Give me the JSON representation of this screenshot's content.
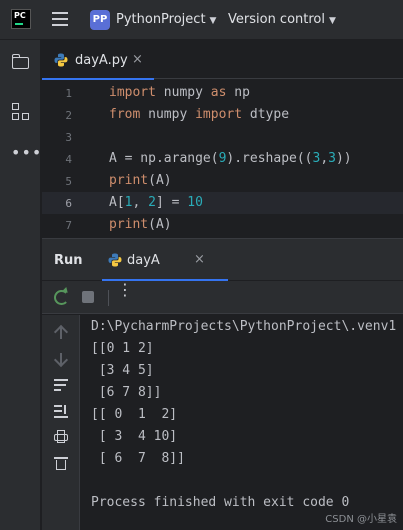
{
  "topbar": {
    "logo_text": "PC",
    "project_badge": "PP",
    "project_name": "PythonProject",
    "vcs_label": "Version control"
  },
  "editor_tab": {
    "filename": "dayA.py",
    "close": "×"
  },
  "code_lines": [
    {
      "num": "1"
    },
    {
      "num": "2"
    },
    {
      "num": "3"
    },
    {
      "num": "4"
    },
    {
      "num": "5"
    },
    {
      "num": "6"
    },
    {
      "num": "7"
    }
  ],
  "code": {
    "l1_kw1": "import",
    "l1_mod": " numpy ",
    "l1_kw2": "as",
    "l1_alias": " np",
    "l2_kw1": "from",
    "l2_mod": " numpy ",
    "l2_kw2": "import",
    "l2_name": " dtype",
    "l4_a": "A = np.arange(",
    "l4_n1": "9",
    "l4_b": ").reshape((",
    "l4_n2": "3",
    "l4_c": ",",
    "l4_n3": "3",
    "l4_d": "))",
    "l5_fn": "print",
    "l5_rest": "(A)",
    "l6_a": "A[",
    "l6_n1": "1",
    "l6_b": ", ",
    "l6_n2": "2",
    "l6_c": "] = ",
    "l6_n3": "10",
    "l7_fn": "print",
    "l7_rest": "(A)"
  },
  "run_panel": {
    "title": "Run",
    "tab_label": "dayA",
    "close": "×"
  },
  "console": {
    "lines": [
      "D:\\PycharmProjects\\PythonProject\\.venv1",
      "[[0 1 2]",
      " [3 4 5]",
      " [6 7 8]]",
      "[[ 0  1  2]",
      " [ 3  4 10]",
      " [ 6  7  8]]",
      "",
      "Process finished with exit code 0"
    ]
  },
  "watermark": "CSDN @小星袁",
  "colors": {
    "accent": "#3574f0",
    "keyword": "#cf8e6d",
    "number": "#2aacb8",
    "function": "#56a8f5"
  }
}
